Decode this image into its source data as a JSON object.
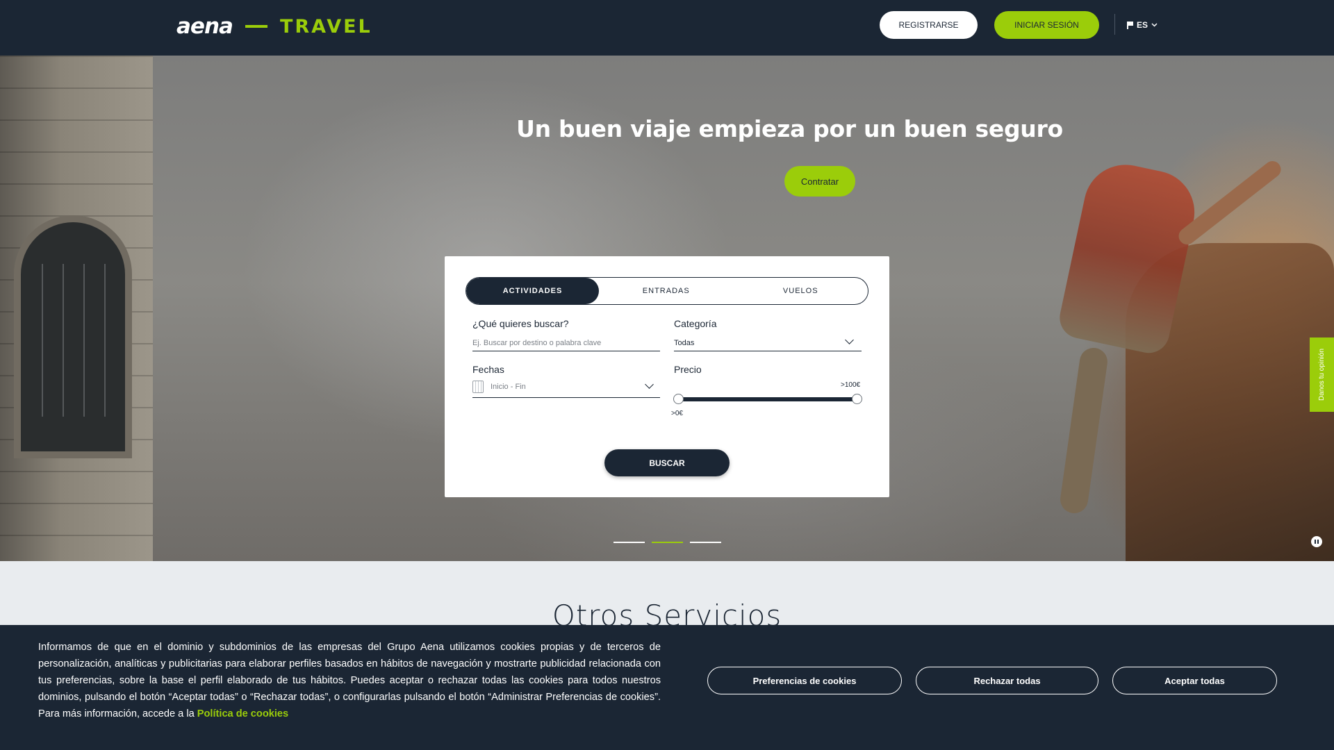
{
  "header": {
    "logo_main": "aena",
    "logo_sub": "TRAVEL",
    "register_label": "REGISTRARSE",
    "login_label": "INICIAR SESIÓN",
    "language": "ES"
  },
  "hero": {
    "title": "Un buen viaje empieza por un buen seguro",
    "cta_label": "Contratar",
    "carousel": {
      "total_slides": 3,
      "active_slide": 2
    }
  },
  "search": {
    "tabs": [
      {
        "label": "ACTIVIDADES",
        "active": true
      },
      {
        "label": "ENTRADAS",
        "active": false
      },
      {
        "label": "VUELOS",
        "active": false
      }
    ],
    "query_label": "¿Qué quieres buscar?",
    "query_placeholder": "Ej. Buscar por destino o palabra clave",
    "category_label": "Categoría",
    "category_value": "Todas",
    "dates_label": "Fechas",
    "dates_placeholder": "Inicio - Fin",
    "price_label": "Precio",
    "price_min": ">0€",
    "price_max": ">100€",
    "search_button": "BUSCAR"
  },
  "feedback_tab": "Danos tu opinión",
  "section_title": "Otros Servicios",
  "cookies": {
    "text": "Informamos de que en el dominio y subdominios de las empresas del Grupo Aena utilizamos cookies propias y de terceros de personalización, analíticas y publicitarias para elaborar perfiles basados en hábitos de navegación y mostrarte publicidad relacionada con tus preferencias, sobre la base el perfil elaborado de tus hábitos. Puedes aceptar o rechazar todas las cookies para todos nuestros dominios, pulsando el botón “Aceptar todas” o “Rechazar todas”, o configurarlas pulsando el botón “Administrar Preferencias de cookies”. Para más información, accede a la",
    "link_label": "Política de cookies",
    "preferences_button": "Preferencias de cookies",
    "reject_button": "Rechazar todas",
    "accept_button": "Aceptar todas"
  },
  "colors": {
    "navy": "#1b2634",
    "accent_green": "#9bcd0a",
    "white": "#ffffff"
  }
}
